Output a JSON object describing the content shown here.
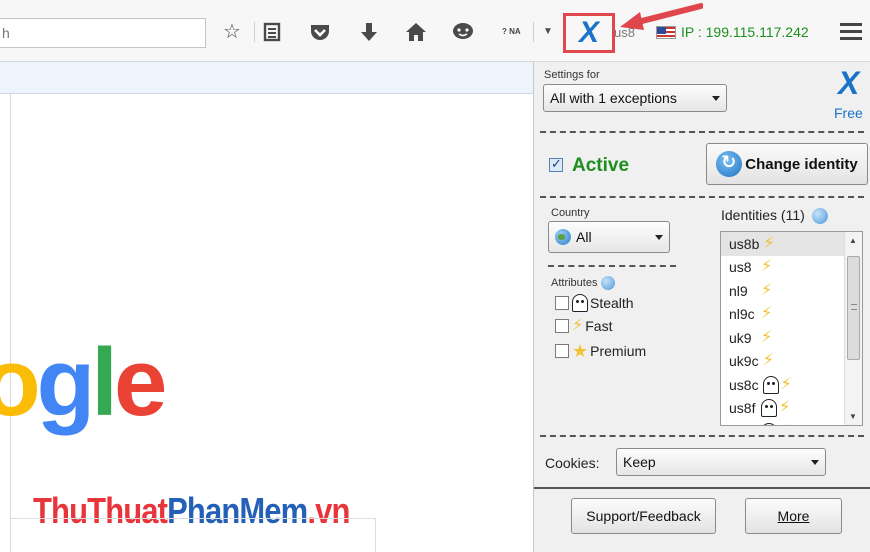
{
  "toolbar": {
    "search_placeholder": "h",
    "icons": [
      "star-icon",
      "reading-list-icon",
      "pocket-icon",
      "download-icon",
      "home-icon",
      "chat-icon",
      "question-na-icon",
      "dropdown-icon",
      "xvpn-icon",
      "menu-icon"
    ],
    "question_na_label": "? NA",
    "x_label": "X",
    "country_code": "us8",
    "ip_text": "IP : 199.115.117.242",
    "ip_color": "#1e8f1e"
  },
  "page": {
    "google_partial": [
      "o",
      "g",
      "l",
      "e"
    ],
    "watermark": {
      "part1": "ThuThuat",
      "part2": "PhanMem",
      "part3": ".vn"
    }
  },
  "panel": {
    "settings_for_label": "Settings for",
    "settings_value": "All with 1 exceptions",
    "logo_letter": "X",
    "free_label": "Free",
    "active_checked": true,
    "active_label": "Active",
    "change_identity_label": "Change identity",
    "country_label": "Country",
    "country_value": "All",
    "attributes_label": "Attributes",
    "attributes": [
      {
        "label": "Stealth",
        "icon": "ghost-icon",
        "checked": false
      },
      {
        "label": "Fast",
        "icon": "bolt-icon",
        "checked": false
      },
      {
        "label": "Premium",
        "icon": "star-icon",
        "checked": false
      }
    ],
    "identities_label": "Identities (11)",
    "identities": [
      {
        "name": "us8b",
        "icons": [
          "bolt-icon"
        ]
      },
      {
        "name": "us8",
        "icons": [
          "bolt-icon"
        ]
      },
      {
        "name": "nl9",
        "icons": [
          "bolt-icon"
        ]
      },
      {
        "name": "nl9c",
        "icons": [
          "bolt-icon"
        ]
      },
      {
        "name": "uk9",
        "icons": [
          "bolt-icon"
        ]
      },
      {
        "name": "uk9c",
        "icons": [
          "bolt-icon"
        ]
      },
      {
        "name": "us8c",
        "icons": [
          "ghost-icon",
          "bolt-icon"
        ]
      },
      {
        "name": "us8f",
        "icons": [
          "ghost-icon",
          "bolt-icon"
        ]
      },
      {
        "name": "",
        "icons": [
          "ghost-icon",
          "bolt-icon"
        ]
      }
    ],
    "cookies_label": "Cookies:",
    "cookies_value": "Keep",
    "support_label": "Support/Feedback",
    "more_label": "More",
    "accent": "#1a73c9",
    "active_color": "#1e8f1e"
  }
}
